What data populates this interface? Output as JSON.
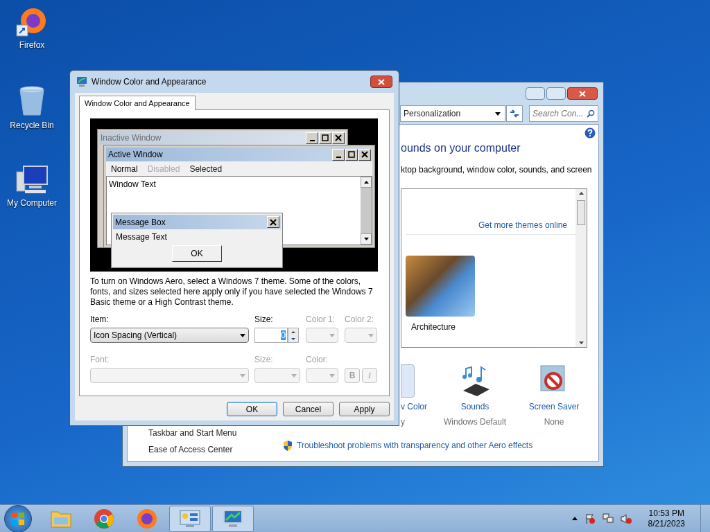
{
  "desktop_icons": [
    {
      "label": "Firefox",
      "kind": "firefox"
    },
    {
      "label": "Recycle Bin",
      "kind": "recycle"
    },
    {
      "label": "My Computer",
      "kind": "computer"
    }
  ],
  "background_window": {
    "address": "Personalization",
    "search_placeholder": "Search Con...",
    "heading": "ounds on your computer",
    "description": "ktop background, window color, sounds, and screen",
    "themes_link": "Get more themes online",
    "theme_label": "Architecture",
    "settings": [
      {
        "label": "v Color",
        "value": "y",
        "kind": "color"
      },
      {
        "label": "Sounds",
        "value": "Windows Default",
        "kind": "sounds"
      },
      {
        "label": "Screen Saver",
        "value": "None",
        "kind": "screensaver"
      }
    ],
    "see_also": [
      "Taskbar and Start Menu",
      "Ease of Access Center"
    ],
    "troubleshoot_link": "Troubleshoot problems with transparency and other Aero effects"
  },
  "dialog": {
    "title": "Window Color and Appearance",
    "tab": {
      "label": "Window Color and Appearance",
      "selected": true
    },
    "preview": {
      "inactive_title": "Inactive Window",
      "active_title": "Active Window",
      "menu": [
        {
          "label": "Normal",
          "kind": "normal"
        },
        {
          "label": "Disabled",
          "kind": "disabled"
        },
        {
          "label": "Selected",
          "kind": "selected"
        }
      ],
      "window_text": "Window Text",
      "message_box_title": "Message Box",
      "message_text": "Message Text",
      "ok_label": "OK"
    },
    "description": "To turn on Windows Aero, select a Windows 7 theme.  Some of the colors, fonts, and sizes selected here apply only if you have selected the Windows 7 Basic theme or a High Contrast theme.",
    "item": {
      "label": "Item:",
      "value": "Icon Spacing (Vertical)",
      "disabled": false
    },
    "size": {
      "label": "Size:",
      "value": "0",
      "disabled": false
    },
    "color1": {
      "label": "Color 1:",
      "disabled": true
    },
    "color2": {
      "label": "Color 2:",
      "disabled": true
    },
    "font": {
      "label": "Font:",
      "disabled": true
    },
    "font_size": {
      "label": "Size:",
      "disabled": true
    },
    "font_color": {
      "label": "Color:",
      "disabled": true
    },
    "bold": {
      "label": "B",
      "disabled": true
    },
    "italic": {
      "label": "I",
      "disabled": true
    },
    "buttons": [
      {
        "label": "OK",
        "default": true
      },
      {
        "label": "Cancel",
        "default": false
      },
      {
        "label": "Apply",
        "default": false
      }
    ]
  },
  "taskbar": {
    "apps": [
      {
        "kind": "explorer",
        "active": false
      },
      {
        "kind": "chrome",
        "active": false
      },
      {
        "kind": "firefox",
        "active": false
      },
      {
        "kind": "control-panel",
        "active": true
      },
      {
        "kind": "display",
        "active": true
      }
    ],
    "time": "10:53 PM",
    "date": "8/21/2023"
  }
}
